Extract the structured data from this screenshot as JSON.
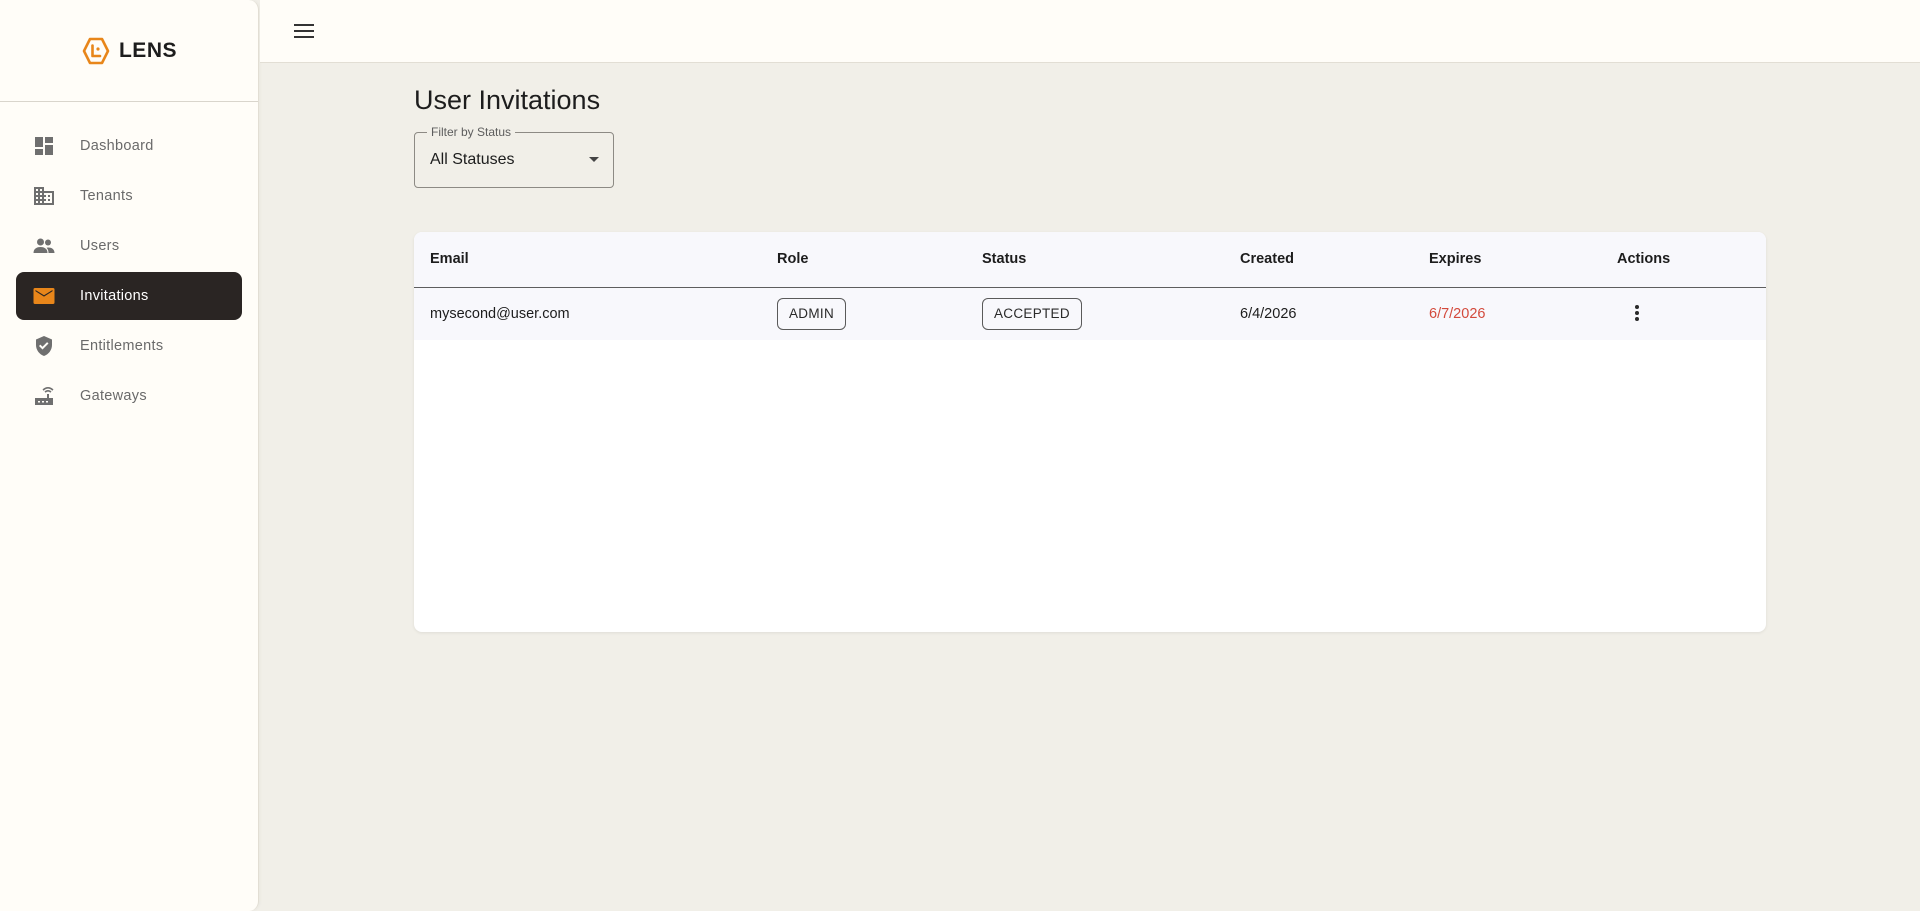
{
  "brand": {
    "name": "LENS"
  },
  "sidebar": {
    "items": [
      {
        "label": "Dashboard",
        "icon": "dashboard-icon",
        "active": false
      },
      {
        "label": "Tenants",
        "icon": "building-icon",
        "active": false
      },
      {
        "label": "Users",
        "icon": "people-icon",
        "active": false
      },
      {
        "label": "Invitations",
        "icon": "mail-icon",
        "active": true
      },
      {
        "label": "Entitlements",
        "icon": "shield-check-icon",
        "active": false
      },
      {
        "label": "Gateways",
        "icon": "router-icon",
        "active": false
      }
    ]
  },
  "topbar": {
    "menu_icon": "hamburger-menu-icon"
  },
  "page": {
    "title": "User Invitations",
    "filter": {
      "label": "Filter by Status",
      "value": "All Statuses"
    }
  },
  "table": {
    "columns": [
      "Email",
      "Role",
      "Status",
      "Created",
      "Expires",
      "Actions"
    ],
    "rows": [
      {
        "email": "mysecond@user.com",
        "role": "ADMIN",
        "status": "ACCEPTED",
        "created": "6/4/2026",
        "expires": "6/7/2026"
      }
    ]
  },
  "colors": {
    "accent": "#e8861a",
    "active_nav_bg": "#2a2523",
    "expired_text": "#d34a3c",
    "page_bg": "#f1efe8"
  }
}
